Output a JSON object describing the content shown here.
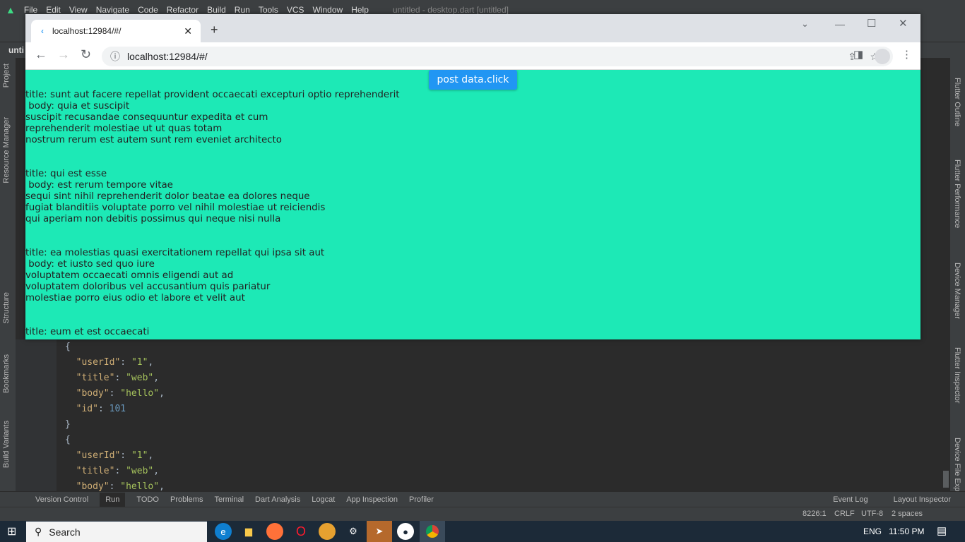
{
  "ide": {
    "menu": [
      "File",
      "Edit",
      "View",
      "Navigate",
      "Code",
      "Refactor",
      "Build",
      "Run",
      "Tools",
      "VCS",
      "Window",
      "Help"
    ],
    "window_title": "untitled - desktop.dart [untitled]",
    "project_label": "unti",
    "left_tools": [
      "Project",
      "Resource Manager",
      "Structure",
      "Bookmarks",
      "Build Variants"
    ],
    "right_tools": [
      "Flutter Outline",
      "Flutter Performance",
      "Device Manager",
      "Flutter Inspector",
      "Device File Exp"
    ],
    "code_lines": [
      [
        "{"
      ],
      [
        "  ",
        "\"userId\"",
        ": ",
        "\"1\"",
        ","
      ],
      [
        "  ",
        "\"title\"",
        ": ",
        "\"web\"",
        ","
      ],
      [
        "  ",
        "\"body\"",
        ": ",
        "\"hello\"",
        ","
      ],
      [
        "  ",
        "\"id\"",
        ": ",
        "101",
        ""
      ],
      [
        "}"
      ],
      [
        "{"
      ],
      [
        "  ",
        "\"userId\"",
        ": ",
        "\"1\"",
        ","
      ],
      [
        "  ",
        "\"title\"",
        ": ",
        "\"web\"",
        ","
      ],
      [
        "  ",
        "\"body\"",
        ": ",
        "\"hello\"",
        ","
      ]
    ],
    "bottom_tools": [
      "Version Control",
      "Run",
      "TODO",
      "Problems",
      "Terminal",
      "Dart Analysis",
      "Logcat",
      "App Inspection",
      "Profiler"
    ],
    "bottom_right_tools": [
      "Event Log",
      "Layout Inspector"
    ],
    "status": {
      "position": "8226:1",
      "line_ending": "CRLF",
      "encoding": "UTF-8",
      "indent": "2 spaces"
    }
  },
  "browser": {
    "tab_title": "localhost:12984/#/",
    "url": "localhost:12984/#/",
    "page": {
      "button_label": "post data.click",
      "posts": [
        {
          "lines": [
            "title: sunt aut facere repellat provident occaecati excepturi optio reprehenderit",
            " body: quia et suscipit",
            "suscipit recusandae consequuntur expedita et cum",
            "reprehenderit molestiae ut ut quas totam",
            "nostrum rerum est autem sunt rem eveniet architecto"
          ]
        },
        {
          "lines": [
            "title: qui est esse",
            " body: est rerum tempore vitae",
            "sequi sint nihil reprehenderit dolor beatae ea dolores neque",
            "fugiat blanditiis voluptate porro vel nihil molestiae ut reiciendis",
            "qui aperiam non debitis possimus qui neque nisi nulla"
          ]
        },
        {
          "lines": [
            "title: ea molestias quasi exercitationem repellat qui ipsa sit aut",
            " body: et iusto sed quo iure",
            "voluptatem occaecati omnis eligendi aut ad",
            "voluptatem doloribus vel accusantium quis pariatur",
            "molestiae porro eius odio et labore et velit aut"
          ]
        },
        {
          "lines": [
            "title: eum et est occaecati"
          ]
        }
      ]
    }
  },
  "taskbar": {
    "search_placeholder": "Search",
    "language": "ENG",
    "time": "11:50 PM"
  },
  "colors": {
    "page_bg": "#1de9b6",
    "button": "#2196f3"
  }
}
